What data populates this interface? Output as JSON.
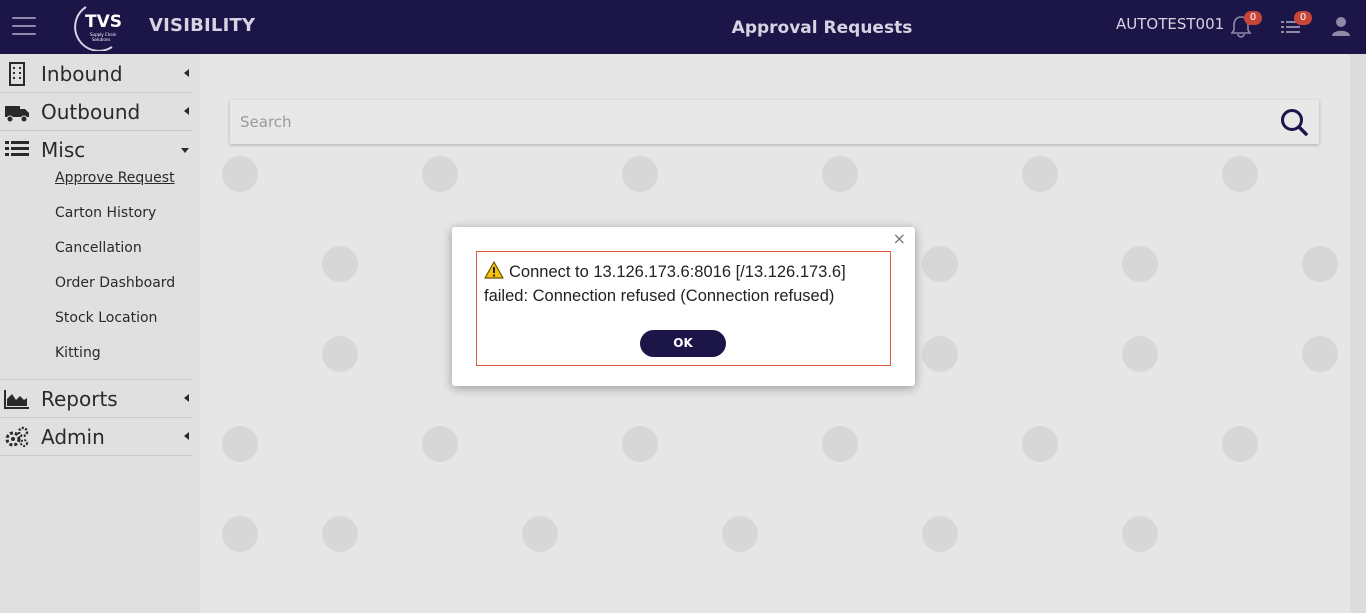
{
  "header": {
    "brand": "VISIBILITY",
    "logo_text": "TVS",
    "logo_subtext": "Supply Chain Solutions",
    "page_title": "Approval Requests",
    "username": "AUTOTEST001",
    "notifications_count": "0",
    "tasks_count": "0"
  },
  "sidebar": {
    "items": [
      {
        "label": "Inbound"
      },
      {
        "label": "Outbound"
      },
      {
        "label": "Misc"
      },
      {
        "label": "Reports"
      },
      {
        "label": "Admin"
      }
    ],
    "misc_sub": [
      {
        "label": "Approve Request"
      },
      {
        "label": "Carton History"
      },
      {
        "label": "Cancellation"
      },
      {
        "label": "Order Dashboard"
      },
      {
        "label": "Stock Location"
      },
      {
        "label": "Kitting"
      }
    ]
  },
  "search": {
    "placeholder": "Search",
    "value": ""
  },
  "dialog": {
    "message": "Connect to 13.126.173.6:8016 [/13.126.173.6] failed: Connection refused (Connection refused)",
    "ok_label": "OK",
    "close_symbol": "×"
  },
  "colors": {
    "topbar": "#1c1548",
    "accent": "#1c1548",
    "dialog_border": "#e35a3a",
    "badge": "#c8453a"
  }
}
